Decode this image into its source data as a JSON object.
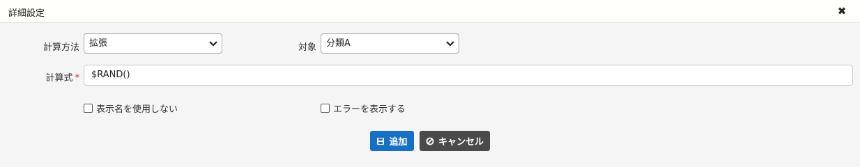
{
  "dialog": {
    "title": "詳細設定",
    "close_icon": "close-icon"
  },
  "form": {
    "method_label": "計算方法",
    "method_value": "拡張",
    "target_label": "対象",
    "target_value": "分類A",
    "formula_label": "計算式",
    "formula_required": "*",
    "formula_value": "$RAND()",
    "checkbox_hide_name": "表示名を使用しない",
    "checkbox_show_error": "エラーを表示する"
  },
  "buttons": {
    "add_label": "追加",
    "cancel_label": "キャンセル"
  },
  "colors": {
    "add_button": "#1670c4",
    "cancel_button": "#4a4a4a",
    "required": "#dd2222"
  }
}
